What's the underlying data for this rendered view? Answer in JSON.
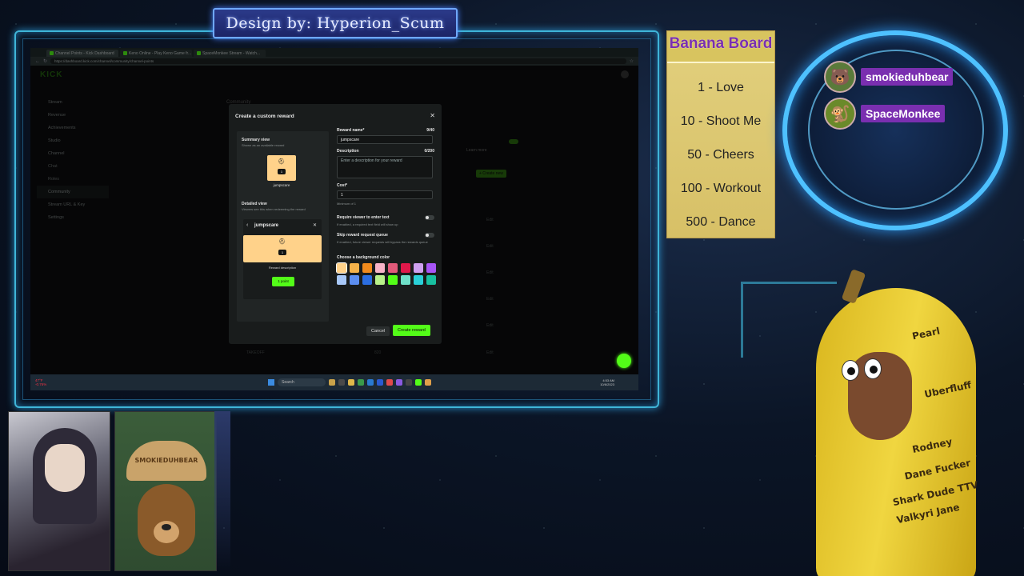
{
  "overlay": {
    "design_credit": "Design by: Hyperion_Scum"
  },
  "browser": {
    "tabs": [
      "Channel Points - Kick Dashboard",
      "Keno Online - Play Keno Game fr...",
      "SpaceMonkee Stream - Watch..."
    ],
    "url": "https://dashboard.kick.com/channel/community/channel-points"
  },
  "kick": {
    "logo": "KICK",
    "sidebar": [
      "Stream",
      "Revenue",
      "Achievements",
      "Studio",
      "Channel",
      "Chat",
      "Roles",
      "Community",
      "Stream URL & Key",
      "Settings"
    ],
    "page_title": "Community",
    "learn_more": "Learn more",
    "create_new": "+ Create new",
    "bottom_reward": "TAKEOFF",
    "bottom_cost": "820",
    "edit": "Edit"
  },
  "modal": {
    "title": "Create a custom reward",
    "summary_title": "Summary view",
    "summary_hint": "Shown as an available reward",
    "reward_cost_badge": "1",
    "reward_name_preview": "jumpscare",
    "detailed_title": "Detailed view",
    "detailed_hint": "Viewers see this when redeeming the reward",
    "detail_name": "jumpscare",
    "reward_description_placeholder": "Reward description",
    "point_button": "1 point",
    "reward_name_label": "Reward name*",
    "reward_name_count": "9/40",
    "reward_name_value": "jumpscare",
    "description_label": "Description",
    "description_count": "0/200",
    "description_placeholder": "Enter a description for your reward",
    "cost_label": "Cost*",
    "cost_value": "1",
    "cost_hint": "Minimum of 1",
    "require_text_label": "Require viewer to enter text",
    "require_text_hint": "If enabled, a required text field will show up",
    "skip_queue_label": "Skip reward request queue",
    "skip_queue_hint": "If enabled, future viewer requests will bypass the rewards queue",
    "color_label": "Choose a background color",
    "colors": [
      "#ffd28a",
      "#f5b24a",
      "#f08a1c",
      "#f7b3c8",
      "#e25a7a",
      "#e0184a",
      "#cfa0f0",
      "#a855f7",
      "#a8c8f8",
      "#5c8ef0",
      "#2b6de0",
      "#b8f08a",
      "#53fc18",
      "#6fe0c8",
      "#2ad0d8",
      "#18c0a0"
    ],
    "cancel": "Cancel",
    "create": "Create reward"
  },
  "taskbar": {
    "search": "Search",
    "weather_temp": "47°F",
    "weather_change": "-0.76%",
    "time": "4:53 AM",
    "date": "10/6/2023"
  },
  "banana_board": {
    "title": "Banana Board",
    "items": [
      "1 - Love",
      "10 - Shoot Me",
      "50 - Cheers",
      "100 - Workout",
      "500 - Dance"
    ]
  },
  "viewers": [
    "smokieduhbear",
    "SpaceMonkee"
  ],
  "cam": {
    "hat_text": "SMOKIEDUHBEAR"
  },
  "costume_words": [
    "Uberfluff",
    "Rodney",
    "Dane Fucker",
    "Shark Dude TTV",
    "Valkyri Jane",
    "Pearl"
  ]
}
